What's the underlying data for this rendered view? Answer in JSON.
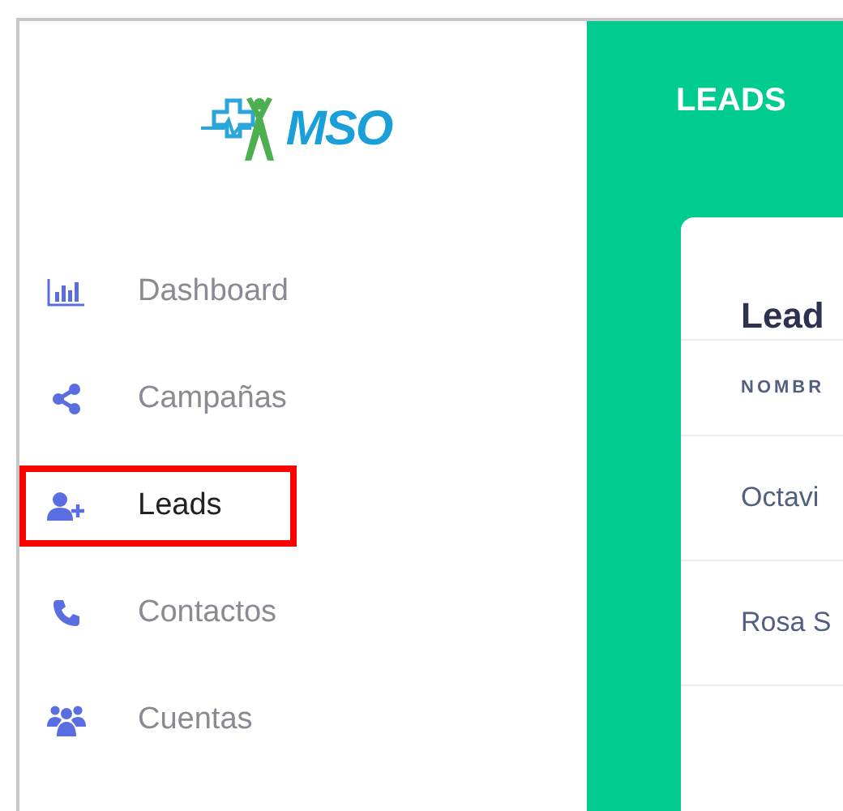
{
  "logo": {
    "text": "MSO"
  },
  "sidebar": {
    "items": [
      {
        "label": "Dashboard",
        "selected": false
      },
      {
        "label": "Campañas",
        "selected": false
      },
      {
        "label": "Leads",
        "selected": true
      },
      {
        "label": "Contactos",
        "selected": false
      },
      {
        "label": "Cuentas",
        "selected": false
      }
    ]
  },
  "header": {
    "title": "LEADS"
  },
  "card": {
    "title": "Lead",
    "columns": [
      "NOMBR"
    ],
    "rows": [
      "Octavi",
      "Rosa S"
    ]
  }
}
